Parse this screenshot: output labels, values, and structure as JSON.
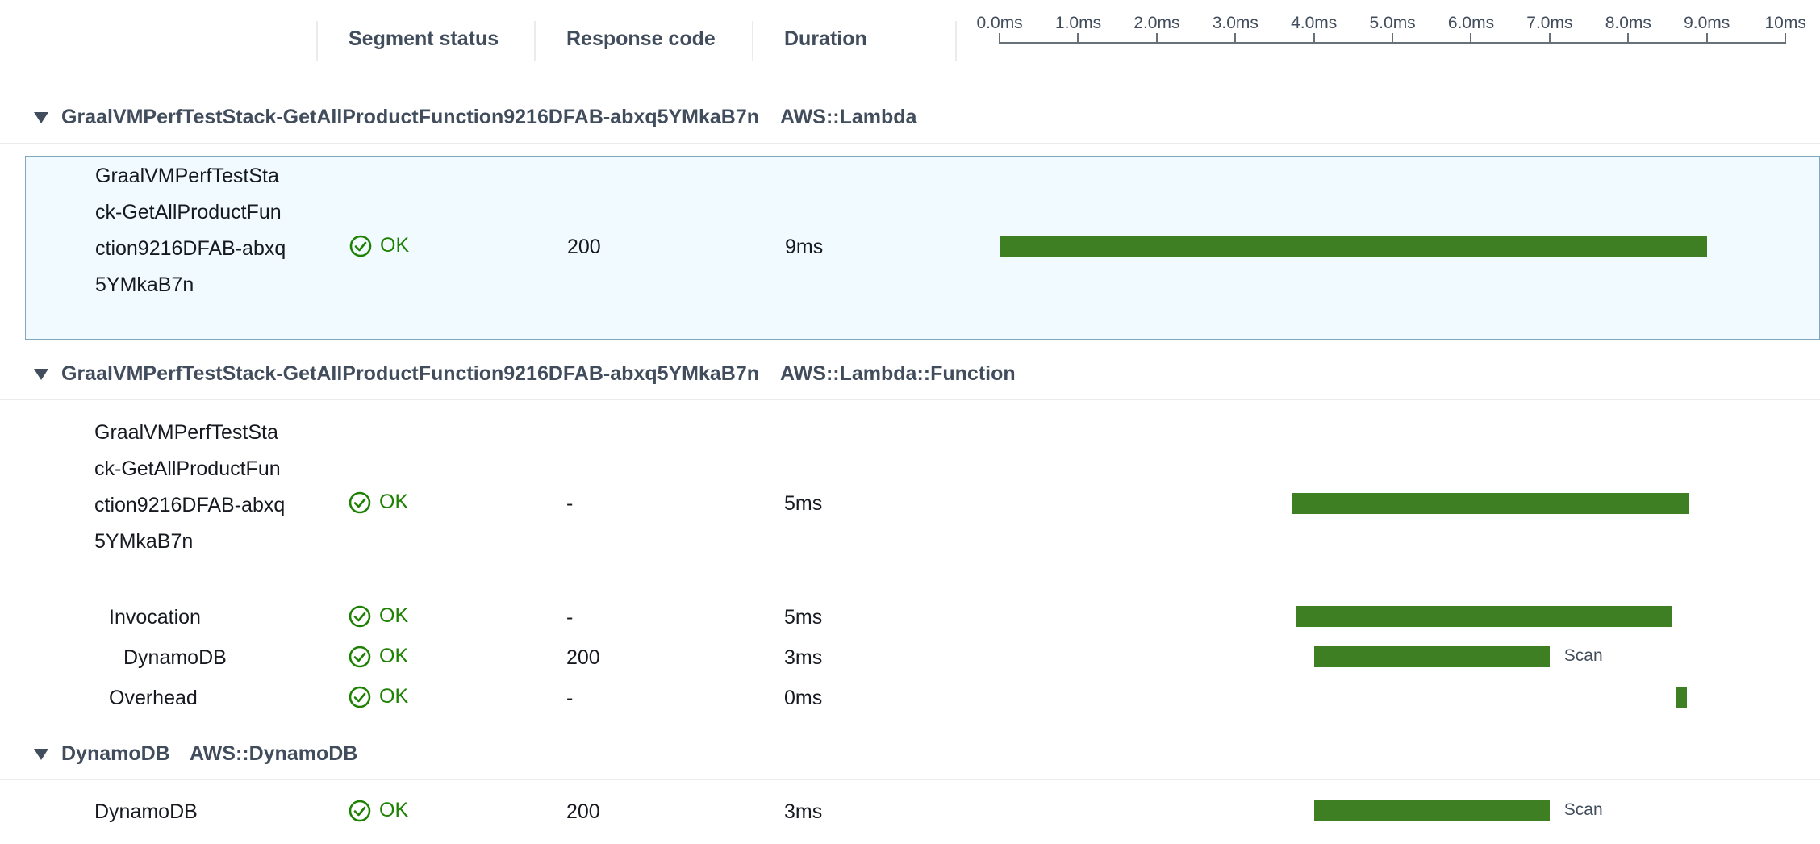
{
  "columns": {
    "segment_status": "Segment status",
    "response_code": "Response code",
    "duration": "Duration"
  },
  "timeline_ticks": [
    "0.0ms",
    "1.0ms",
    "2.0ms",
    "3.0ms",
    "4.0ms",
    "5.0ms",
    "6.0ms",
    "7.0ms",
    "8.0ms",
    "9.0ms",
    "10ms"
  ],
  "groups": [
    {
      "name": "GraalVMPerfTestStack-GetAllProductFunction9216DFAB-abxq5YMkaB7n",
      "type": "AWS::Lambda"
    },
    {
      "name": "GraalVMPerfTestStack-GetAllProductFunction9216DFAB-abxq5YMkaB7n",
      "type": "AWS::Lambda::Function"
    },
    {
      "name": "DynamoDB",
      "type": "AWS::DynamoDB"
    }
  ],
  "rows": [
    {
      "name": "GraalVMPerfTestStack-GetAllProductFunction9216DFAB-abxq5YMkaB7n",
      "status": "OK",
      "code": "200",
      "duration": "9ms",
      "start_ms": 0.0,
      "end_ms": 9.0,
      "label": ""
    },
    {
      "name": "GraalVMPerfTestStack-GetAllProductFunction9216DFAB-abxq5YMkaB7n",
      "status": "OK",
      "code": "-",
      "duration": "5ms",
      "start_ms": 3.73,
      "end_ms": 8.78,
      "label": ""
    },
    {
      "name": "Invocation",
      "status": "OK",
      "code": "-",
      "duration": "5ms",
      "start_ms": 3.78,
      "end_ms": 8.56,
      "label": ""
    },
    {
      "name": "DynamoDB",
      "status": "OK",
      "code": "200",
      "duration": "3ms",
      "start_ms": 4.0,
      "end_ms": 7.0,
      "label": "Scan"
    },
    {
      "name": "Overhead",
      "status": "OK",
      "code": "-",
      "duration": "0ms",
      "start_ms": 8.6,
      "end_ms": 8.75,
      "label": ""
    },
    {
      "name": "DynamoDB",
      "status": "OK",
      "code": "200",
      "duration": "3ms",
      "start_ms": 4.0,
      "end_ms": 7.0,
      "label": "Scan"
    }
  ],
  "colors": {
    "bar": "#3f7f24",
    "ok": "#1d8102",
    "selected_bg": "#f1faff"
  }
}
